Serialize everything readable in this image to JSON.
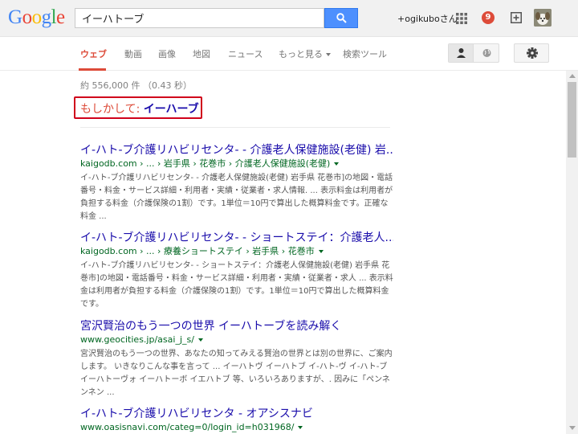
{
  "header": {
    "logo_letters": [
      {
        "ch": "G",
        "color": "#4285f4"
      },
      {
        "ch": "o",
        "color": "#ea4335"
      },
      {
        "ch": "o",
        "color": "#fbbc05"
      },
      {
        "ch": "g",
        "color": "#4285f4"
      },
      {
        "ch": "l",
        "color": "#34a853"
      },
      {
        "ch": "e",
        "color": "#ea4335"
      }
    ],
    "search_value": "イーハトーブ",
    "user_name": "+ogikuboさん",
    "notification_count": "9"
  },
  "nav": {
    "tabs": [
      "ウェブ",
      "動画",
      "画像",
      "地図",
      "ニュース",
      "もっと見る",
      "検索ツール"
    ],
    "active_tab": "ウェブ"
  },
  "stats": "約 556,000 件 （0.43 秒）",
  "did_you_mean": {
    "label": "もしかして:",
    "suggestion": "イーハーブ"
  },
  "results": [
    {
      "title": "イ-ハト-ブ介護リハビリセンタ- - 介護老人保健施設(老健) 岩...",
      "url": "kaigodb.com › ... › 岩手県 › 花巻市 › 介護老人保健施設(老健)",
      "snippet": "イ-ハト-ブ介護リハビリセンタ- - 介護老人保健施設(老健) 岩手県 花巻市]の地図・電話番号・料金・サービス詳細・利用者・実績・従業者・求人情報. ... 表示料金は利用者が負担する料金（介護保険の1割）です。1単位＝10円で算出した概算料金です。正確な料金 ..."
    },
    {
      "title": "イ-ハト-ブ介護リハビリセンタ- - ショートステイ：介護老人...",
      "url": "kaigodb.com › ... › 療養ショートステイ › 岩手県 › 花巻市",
      "snippet": "イ-ハト-ブ介護リハビリセンタ- - ショートステイ：介護老人保健施設(老健) 岩手県 花巻市]の地図・電話番号・料金・サービス詳細・利用者・実績・従業者・求人 ... 表示料金は利用者が負担する料金（介護保険の1割）です。1単位＝10円で算出した概算料金です。"
    },
    {
      "title": "宮沢賢治のもう一つの世界 イーハトーブを読み解く",
      "url": "www.geocities.jp/asai_j_s/",
      "snippet": "宮沢賢治のもう一つの世界、あなたの知ってみえる賢治の世界とは別の世界に、ご案内します。 いきなりこんな事を言って ... イーハトヴ イーハトブ イ-ハト-ヴ イ-ハト-ブ イーハトーヴォ イーハトーボ イエハトブ 等、いろいろありますが、. 因みに「ペンネンネン ..."
    },
    {
      "title": "イ-ハト-ブ介護リハビリセンタ - オアシスナビ",
      "url": "www.oasisnavi.com/categ=0/login_id=h031968/",
      "snippet": ""
    }
  ]
}
